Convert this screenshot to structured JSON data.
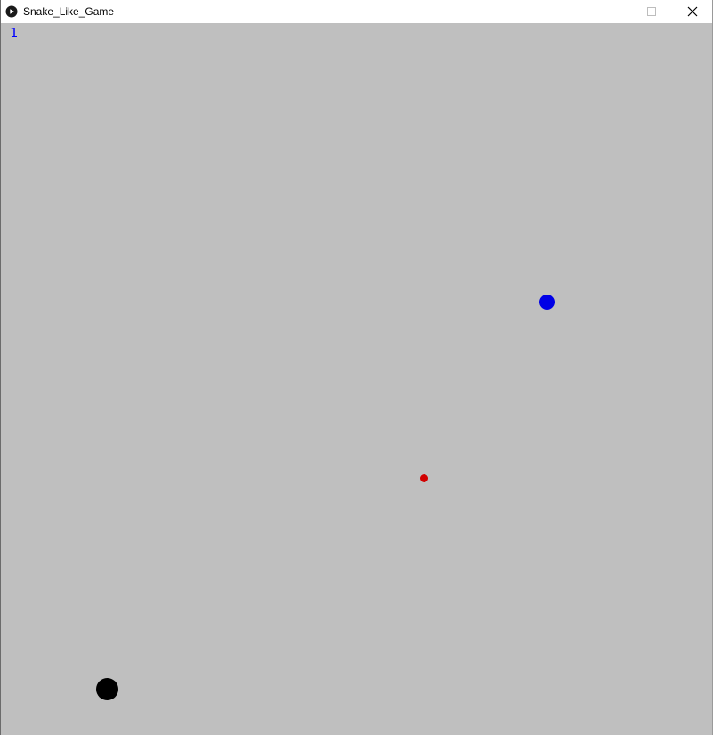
{
  "window": {
    "title": "Snake_Like_Game",
    "controls": [
      "minimize",
      "maximize",
      "close"
    ]
  },
  "game": {
    "score": "1",
    "colors": {
      "background": "#bfbfbf",
      "score_text": "#0000ff",
      "player": "#0000e6",
      "food": "#d10000",
      "enemy": "#000000"
    }
  }
}
